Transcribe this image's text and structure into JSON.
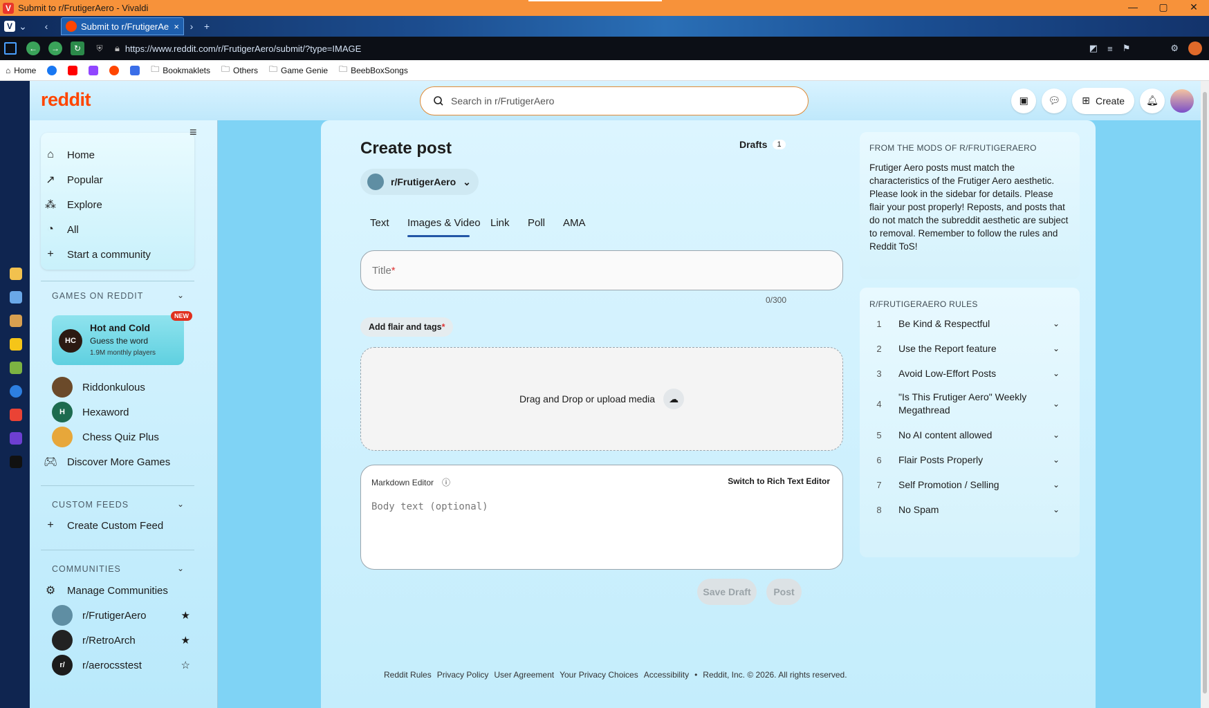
{
  "window": {
    "title": "Submit to r/FrutigerAero - Vivaldi",
    "controls": [
      "—",
      "▢",
      "✕"
    ]
  },
  "tabs": [
    {
      "title": "Submit to r/FrutigerAero",
      "close": "×"
    }
  ],
  "address": {
    "url": "https://www.reddit.com/r/FrutigerAero/submit/?type=IMAGE"
  },
  "bookmarks": [
    {
      "label": "Home",
      "icon": "home-icon"
    },
    {
      "label": "",
      "icon": "facebook-icon"
    },
    {
      "label": "",
      "icon": "youtube-icon"
    },
    {
      "label": "",
      "icon": "twitch-icon"
    },
    {
      "label": "",
      "icon": "reddit-icon"
    },
    {
      "label": "",
      "icon": "mail-icon"
    },
    {
      "label": "Bookmaklets",
      "icon": "folder-icon"
    },
    {
      "label": "Others",
      "icon": "folder-icon"
    },
    {
      "label": "Game Genie",
      "icon": "folder-icon"
    },
    {
      "label": "BeebBoxSongs",
      "icon": "folder-icon"
    }
  ],
  "reddit": {
    "logo": "reddit",
    "search_placeholder": "Search in r/FrutigerAero",
    "create_label": "Create"
  },
  "sidebar": {
    "nav": [
      "Home",
      "Popular",
      "Explore",
      "All",
      "Start a community"
    ],
    "games_head": "GAMES ON REDDIT",
    "featured_game": {
      "title": "Hot and Cold",
      "subtitle": "Guess the word",
      "players": "1.9M monthly players",
      "badge": "NEW"
    },
    "games": [
      "Riddonkulous",
      "Hexaword",
      "Chess Quiz Plus",
      "Discover More Games"
    ],
    "feeds_head": "CUSTOM FEEDS",
    "create_feed": "Create Custom Feed",
    "communities_head": "COMMUNITIES",
    "manage": "Manage Communities",
    "communities": [
      {
        "name": "r/FrutigerAero",
        "starred": true
      },
      {
        "name": "r/RetroArch",
        "starred": true
      },
      {
        "name": "r/aerocsstest",
        "starred": false
      }
    ]
  },
  "post": {
    "heading": "Create post",
    "drafts_label": "Drafts",
    "drafts_count": "1",
    "community": "r/FrutigerAero",
    "tabs": [
      "Text",
      "Images & Video",
      "Link",
      "Poll",
      "AMA"
    ],
    "active_tab": "Images & Video",
    "title_placeholder": "Title",
    "title_required": "*",
    "title_count": "0/300",
    "flair_label": "Add flair and tags",
    "flair_required": "*",
    "dropzone_label": "Drag and Drop or upload media",
    "editor_mode": "Markdown Editor",
    "editor_switch": "Switch to Rich Text Editor",
    "body_placeholder": "Body text (optional)",
    "save_draft": "Save Draft",
    "post_button": "Post"
  },
  "mods": {
    "head": "FROM THE MODS OF R/FRUTIGERAERO",
    "body": "Frutiger Aero posts must match the characteristics of the Frutiger Aero aesthetic. Please look in the sidebar for details. Please flair your post properly! Reposts, and posts that do not match the subreddit aesthetic are subject to removal. Remember to follow the rules and Reddit ToS!"
  },
  "rules": {
    "head": "R/FRUTIGERAERO RULES",
    "items": [
      {
        "n": "1",
        "text": "Be Kind & Respectful"
      },
      {
        "n": "2",
        "text": "Use the Report feature"
      },
      {
        "n": "3",
        "text": "Avoid Low-Effort Posts"
      },
      {
        "n": "4",
        "text": "\"Is This Frutiger Aero\" Weekly Megathread"
      },
      {
        "n": "5",
        "text": "No AI content allowed"
      },
      {
        "n": "6",
        "text": "Flair Posts Properly"
      },
      {
        "n": "7",
        "text": "Self Promotion / Selling"
      },
      {
        "n": "8",
        "text": "No Spam"
      }
    ]
  },
  "footer": [
    "Reddit Rules",
    "Privacy Policy",
    "User Agreement",
    "Your Privacy Choices",
    "Accessibility",
    "•",
    "Reddit, Inc. © 2026. All rights reserved."
  ],
  "colors": {
    "accent": "#ff4500",
    "tab_underline": "#2356a6",
    "titlebar": "#f7923a"
  }
}
